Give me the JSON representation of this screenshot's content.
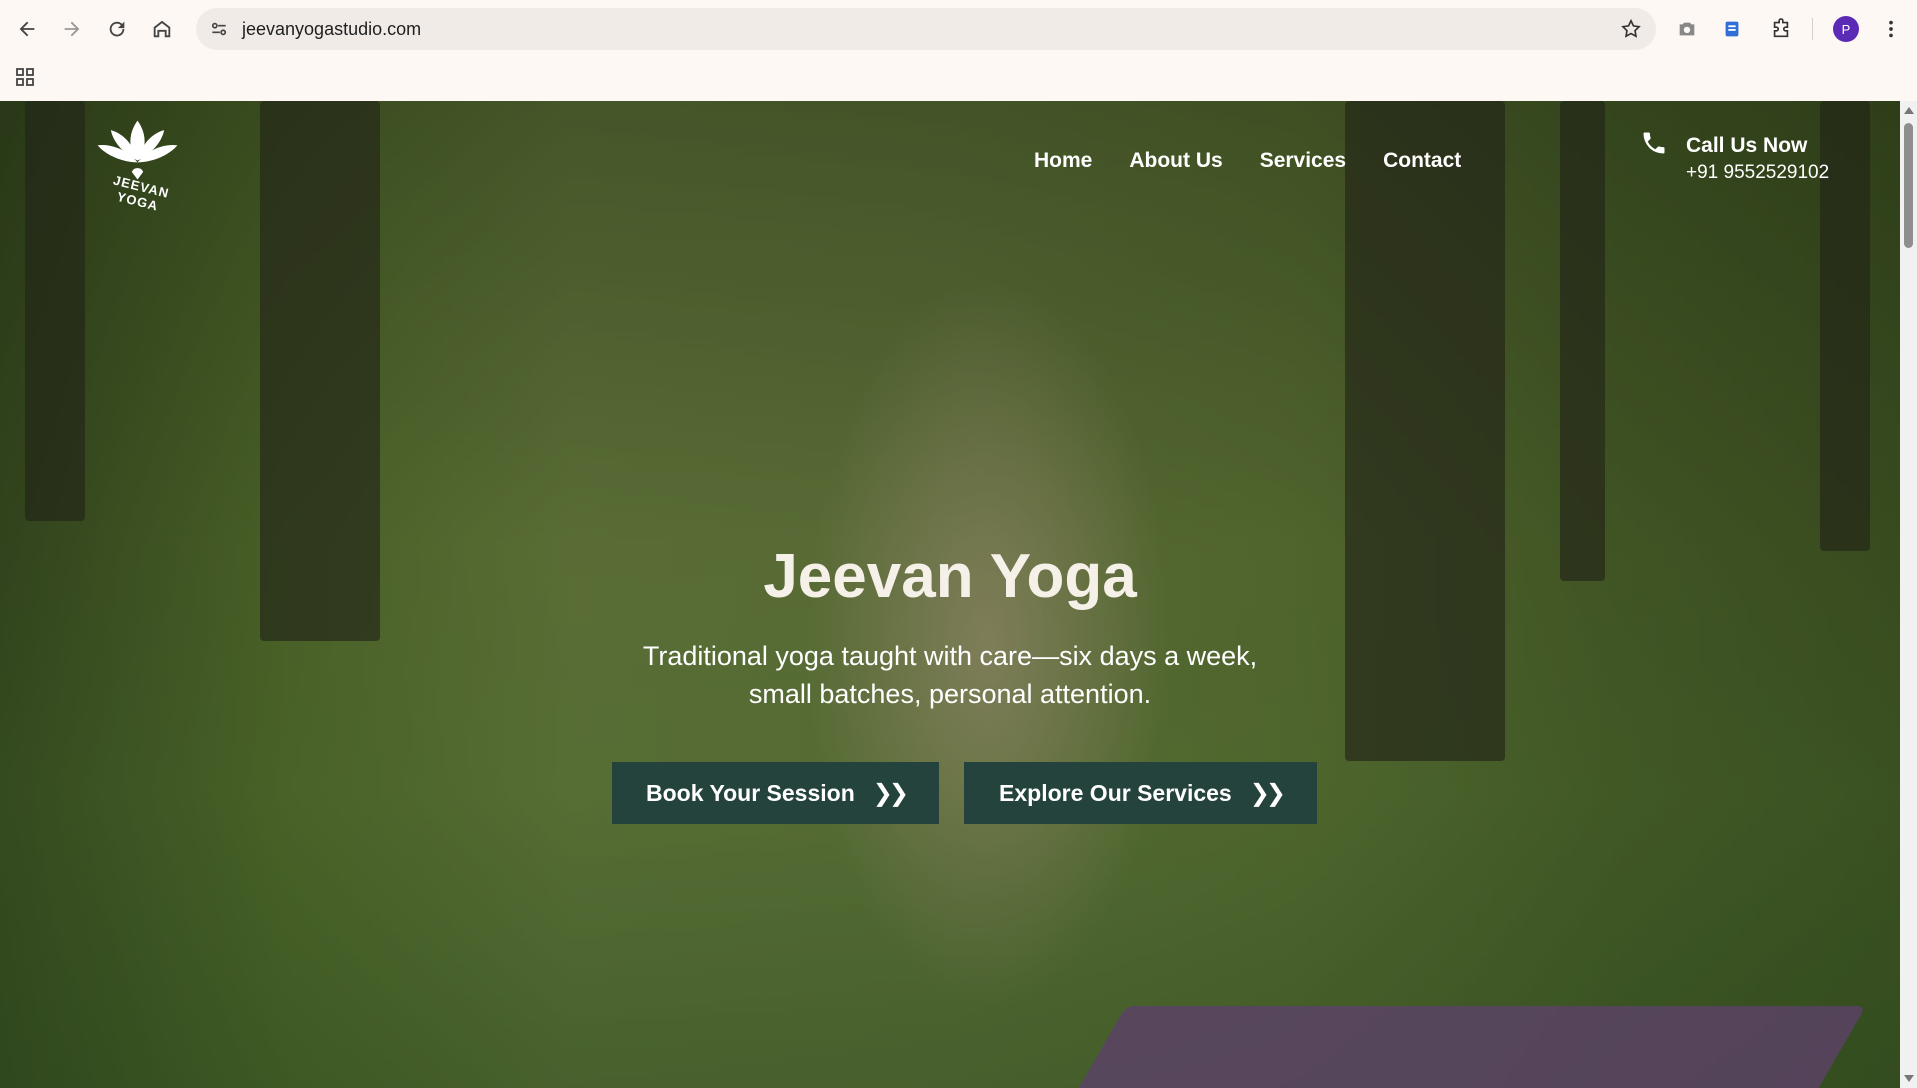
{
  "browser": {
    "url": "jeevanyogastudio.com",
    "profile_initial": "P",
    "icons": [
      "back-icon",
      "forward-icon",
      "reload-icon",
      "home-icon",
      "site-info-icon",
      "bookmark-star-icon",
      "camera-icon",
      "extension-icon",
      "puzzle-icon",
      "menu-icon",
      "apps-grid-icon"
    ],
    "profile_color": "#5b2bb5"
  },
  "site": {
    "logo_text": "JEEVAN YOGA",
    "nav": [
      "Home",
      "About Us",
      "Services",
      "Contact"
    ],
    "call_label": "Call Us Now",
    "call_number": "+91 9552529102",
    "hero_title": "Jeevan Yoga",
    "hero_subtitle_line1": "Traditional yoga taught with care—six days a week,",
    "hero_subtitle_line2": "small batches, personal attention.",
    "cta_primary": "Book Your Session",
    "cta_secondary": "Explore Our Services",
    "cta_color": "#25433d"
  }
}
